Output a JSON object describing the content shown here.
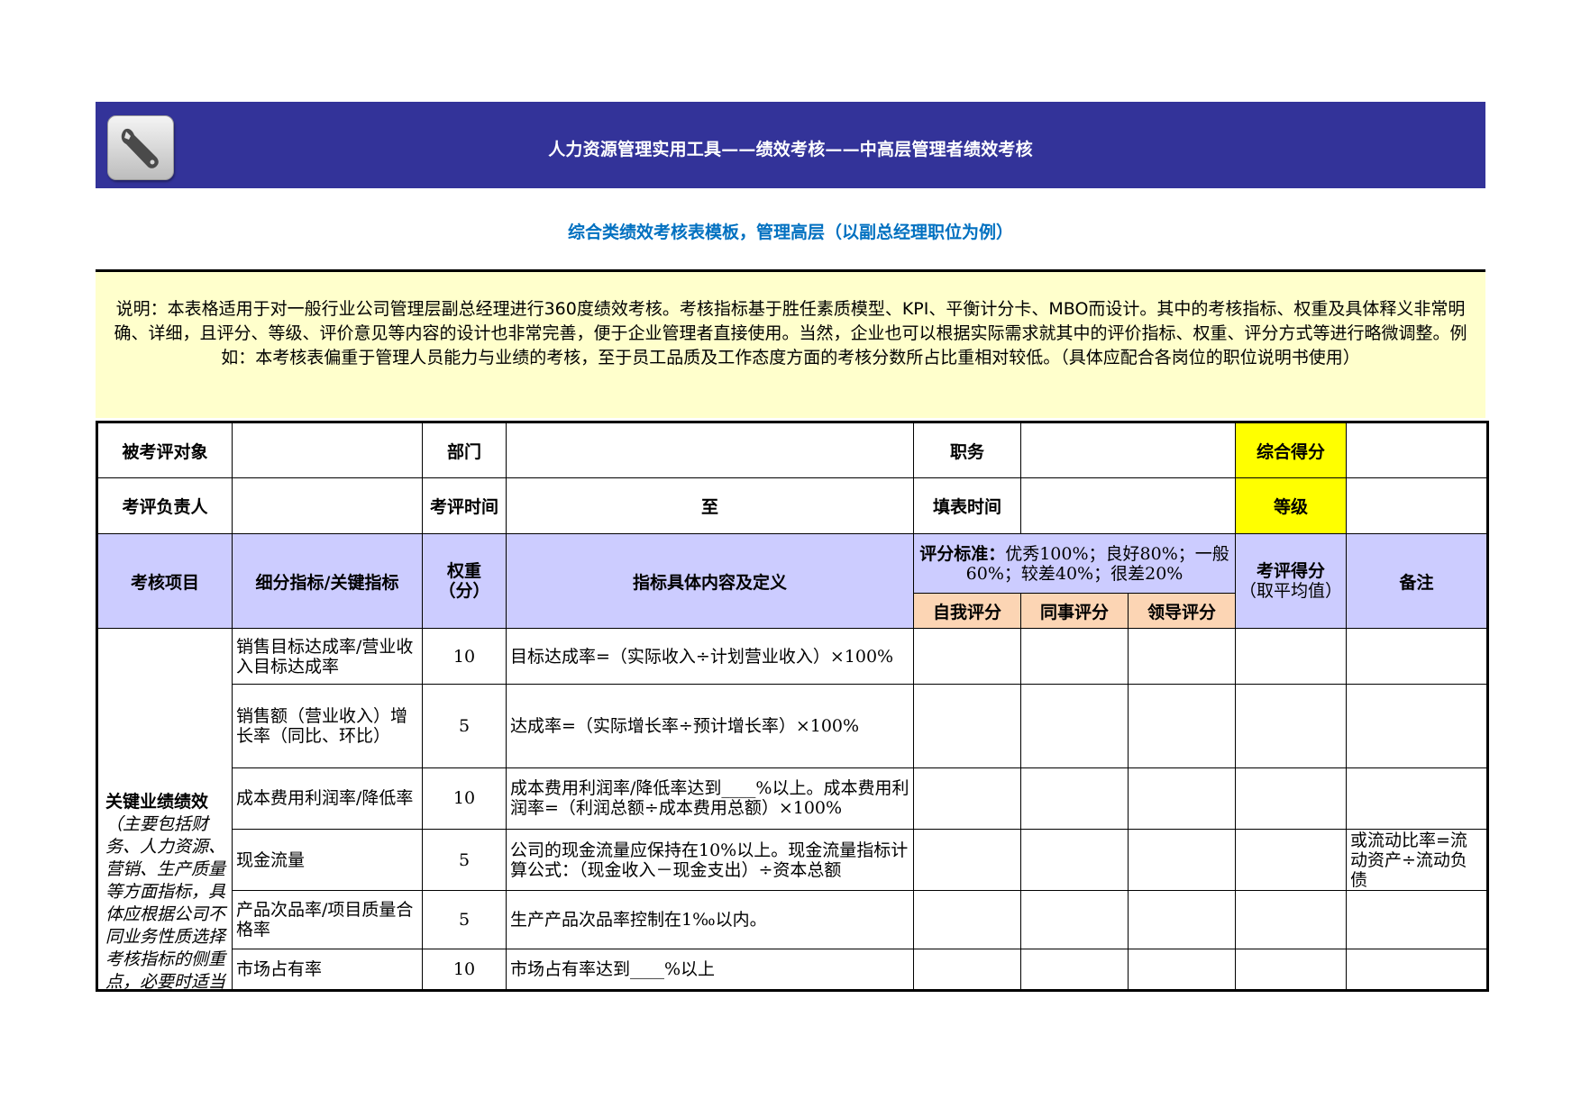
{
  "banner": {
    "title": "人力资源管理实用工具——绩效考核——中高层管理者绩效考核",
    "icon": "wrench-icon",
    "color": "#333399"
  },
  "subtitle": "综合类绩效考核表模板，管理高层（以副总经理职位为例）",
  "description": "说明：本表格适用于对一般行业公司管理层副总经理进行360度绩效考核。考核指标基于胜任素质模型、KPI、平衡计分卡、MBO而设计。其中的考核指标、权重及具体释义非常明确、详细，且评分、等级、评价意见等内容的设计也非常完善，便于企业管理者直接使用。当然，企业也可以根据实际需求就其中的评价指标、权重、评分方式等进行略微调整。例如：本考核表偏重于管理人员能力与业绩的考核，至于员工品质及工作态度方面的考核分数所占比重相对较低。（具体应配合各岗位的职位说明书使用）",
  "info": {
    "subject_label": "被考评对象",
    "dept_label": "部门",
    "position_label": "职务",
    "total_label": "综合得分",
    "reviewer_label": "考评负责人",
    "period_label": "考评时间",
    "period_to": "至",
    "fill_label": "填表时间",
    "grade_label": "等级"
  },
  "headers": {
    "item": "考核项目",
    "sub": "细分指标/关键指标",
    "weight": "权重（分）",
    "definition": "指标具体内容及定义",
    "standard_bold": "评分标准：",
    "standard_text": "优秀100%；良好80%；一般60%；较差40%；很差20%",
    "self": "自我评分",
    "peer": "同事评分",
    "leader": "领导评分",
    "score_bold": "考评得分",
    "score_text": "（取平均值）",
    "remark": "备注"
  },
  "category": {
    "title": "关键业绩绩效",
    "note": "（主要包括财务、人力资源、营销、生产质量等方面指标，具体应根据公司不同业务性质选择考核指标的侧重点，必要时适当的进行增减"
  },
  "rows": [
    {
      "sub": "销售目标达成率/营业收入目标达成率",
      "weight": "10",
      "definition": "目标达成率=（实际收入÷计划营业收入）×100%",
      "remark": ""
    },
    {
      "sub": "销售额（营业收入）增长率（同比、环比）",
      "weight": "5",
      "definition": "达成率=（实际增长率÷预计增长率）×100%",
      "remark": ""
    },
    {
      "sub": "成本费用利润率/降低率",
      "weight": "10",
      "definition": "成本费用利润率/降低率达到____%以上。成本费用利润率=（利润总额÷成本费用总额）×100%",
      "remark": ""
    },
    {
      "sub": "现金流量",
      "weight": "5",
      "definition": "公司的现金流量应保持在10%以上。现金流量指标计算公式：（现金收入－现金支出）÷资本总额",
      "remark": "或流动比率=流动资产÷流动负债"
    },
    {
      "sub": "产品次品率/项目质量合格率",
      "weight": "5",
      "definition": "生产产品次品率控制在1‰以内。",
      "remark": ""
    },
    {
      "sub": "市场占有率",
      "weight": "10",
      "definition": "市场占有率达到____%以上",
      "remark": ""
    }
  ]
}
